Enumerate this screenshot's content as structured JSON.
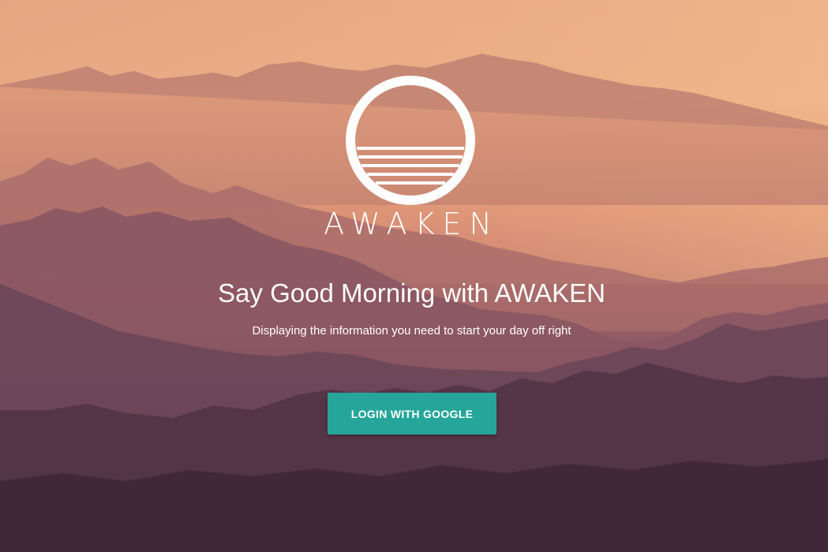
{
  "brand": {
    "name": "AWAKEN",
    "logo_icon": "sunrise-circle-icon"
  },
  "hero": {
    "headline": "Say Good Morning with AWAKEN",
    "subline": "Displaying the information you need to start your day off right"
  },
  "actions": {
    "login_label": "LOGIN WITH GOOGLE"
  },
  "background": {
    "image": "mountain-sunrise-photo"
  },
  "colors": {
    "button": "#26a69a",
    "text": "#ffffff",
    "sky_top": "#e9a984",
    "sky_horizon": "#d98c6f",
    "mountain_far": "#b87a72",
    "mountain_mid": "#8c5a63",
    "mountain_near": "#5e3d50",
    "mountain_front": "#3f283a"
  }
}
